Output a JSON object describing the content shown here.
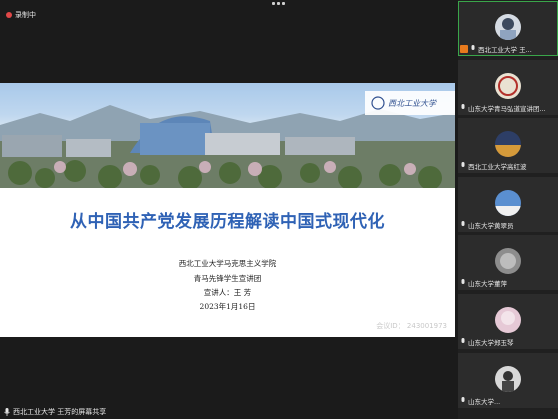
{
  "top": {
    "recording_label": "录制中"
  },
  "slide": {
    "logo_text": "西北工业大学",
    "title": "从中国共产党发展历程解读中国式现代化",
    "lines": [
      "西北工业大学马克思主义学院",
      "青马先锋学生宣讲团",
      "宣讲人：王  芳",
      "2023年1月16日"
    ],
    "watermark": "会议ID： 243001973"
  },
  "bottom": {
    "sharing_label": "西北工业大学 王芳的屏幕共享"
  },
  "participants": [
    {
      "name": "西北工业大学 王...",
      "active": true,
      "host": true
    },
    {
      "name": "山东大学青马弘道宣讲团..."
    },
    {
      "name": "西北工业大学高红波"
    },
    {
      "name": "山东大学黄翠员"
    },
    {
      "name": "山东大学董萍"
    },
    {
      "name": "山东大学郑玉琴"
    },
    {
      "name": "山东大学..."
    }
  ],
  "colors": {
    "title_blue": "#2f62b5",
    "active_border": "#3aa64a",
    "recording_red": "#e04848",
    "host_badge": "#e87a1d"
  }
}
